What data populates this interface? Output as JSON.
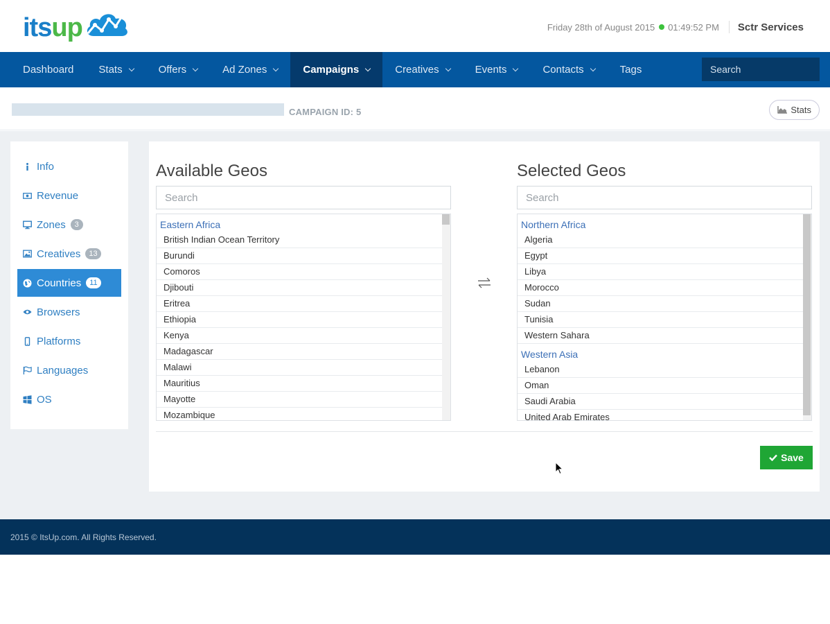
{
  "header": {
    "logo_its": "its",
    "logo_up": "up",
    "date": "Friday 28th of August 2015",
    "time": "01:49:52 PM",
    "user": "Sctr Services"
  },
  "nav": {
    "items": [
      {
        "label": "Dashboard",
        "dropdown": false
      },
      {
        "label": "Stats",
        "dropdown": true
      },
      {
        "label": "Offers",
        "dropdown": true
      },
      {
        "label": "Ad Zones",
        "dropdown": true
      },
      {
        "label": "Campaigns",
        "dropdown": true
      },
      {
        "label": "Creatives",
        "dropdown": true
      },
      {
        "label": "Events",
        "dropdown": true
      },
      {
        "label": "Contacts",
        "dropdown": true
      },
      {
        "label": "Tags",
        "dropdown": false
      }
    ],
    "active_index": 4,
    "search_placeholder": "Search"
  },
  "subheader": {
    "campaign_id_label": "CAMPAIGN ID: 5",
    "stats_button": "Stats"
  },
  "sidebar": {
    "items": [
      {
        "label": "Info",
        "icon": "info-icon",
        "badge": ""
      },
      {
        "label": "Revenue",
        "icon": "money-icon",
        "badge": ""
      },
      {
        "label": "Zones",
        "icon": "desktop-icon",
        "badge": "3"
      },
      {
        "label": "Creatives",
        "icon": "image-icon",
        "badge": "13"
      },
      {
        "label": "Countries",
        "icon": "globe-icon",
        "badge": "11"
      },
      {
        "label": "Browsers",
        "icon": "eye-icon",
        "badge": ""
      },
      {
        "label": "Platforms",
        "icon": "mobile-icon",
        "badge": ""
      },
      {
        "label": "Languages",
        "icon": "flag-icon",
        "badge": ""
      },
      {
        "label": "OS",
        "icon": "windows-icon",
        "badge": ""
      }
    ],
    "active_index": 4
  },
  "available": {
    "title": "Available Geos",
    "search_placeholder": "Search",
    "groups": [
      {
        "name": "Eastern Africa",
        "items": [
          "British Indian Ocean Territory",
          "Burundi",
          "Comoros",
          "Djibouti",
          "Eritrea",
          "Ethiopia",
          "Kenya",
          "Madagascar",
          "Malawi",
          "Mauritius",
          "Mayotte",
          "Mozambique"
        ]
      }
    ]
  },
  "selected": {
    "title": "Selected Geos",
    "search_placeholder": "Search",
    "groups": [
      {
        "name": "Northern Africa",
        "items": [
          "Algeria",
          "Egypt",
          "Libya",
          "Morocco",
          "Sudan",
          "Tunisia",
          "Western Sahara"
        ]
      },
      {
        "name": "Western Asia",
        "items": [
          "Lebanon",
          "Oman",
          "Saudi Arabia",
          "United Arab Emirates"
        ]
      }
    ]
  },
  "save_label": "Save",
  "footer": {
    "text": "2015 © ItsUp.com. All Rights Reserved."
  },
  "colors": {
    "nav_bg": "#04579f",
    "nav_active": "#053a6c",
    "sidebar_active": "#2e8bd6",
    "save_green": "#1fa635",
    "footer_bg": "#04325a"
  }
}
